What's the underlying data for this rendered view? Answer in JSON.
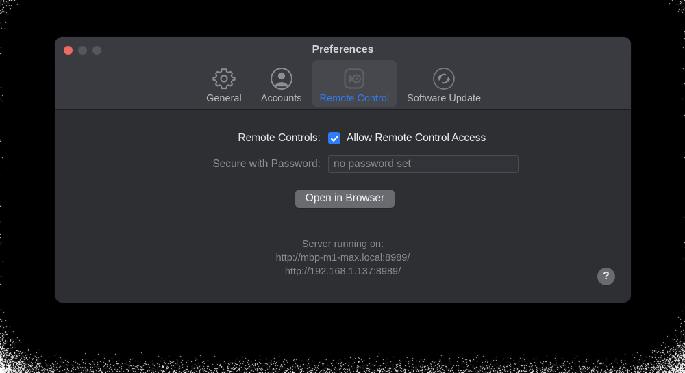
{
  "window": {
    "title": "Preferences",
    "traffic_lights": [
      {
        "name": "close",
        "color": "#ec6a5e"
      },
      {
        "name": "minimize",
        "color": "#56575c"
      },
      {
        "name": "zoom",
        "color": "#56575c"
      }
    ]
  },
  "toolbar": {
    "tabs": [
      {
        "label": "General",
        "icon": "gear-icon",
        "selected": false
      },
      {
        "label": "Accounts",
        "icon": "person-circle-icon",
        "selected": false
      },
      {
        "label": "Remote Control",
        "icon": "remote-control-icon",
        "selected": true
      },
      {
        "label": "Software Update",
        "icon": "refresh-circle-icon",
        "selected": false
      }
    ],
    "selected_tab": "Remote Control",
    "accent_color": "#2f7df6"
  },
  "main": {
    "remote_controls": {
      "label": "Remote Controls:",
      "checkbox_label": "Allow Remote Control Access",
      "checked": true
    },
    "secure_password": {
      "label": "Secure with Password:",
      "placeholder": "no password set",
      "value": "",
      "disabled": true
    },
    "open_in_browser_button": "Open in Browser",
    "server_info": {
      "heading": "Server running on:",
      "urls": [
        "http://mbp-m1-max.local:8989/",
        "http://192.168.1.137:8989/"
      ]
    },
    "help_button": "?"
  }
}
